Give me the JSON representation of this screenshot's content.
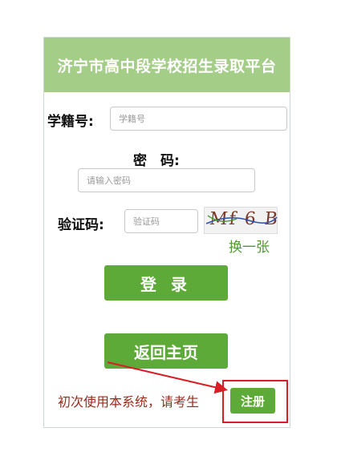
{
  "header": {
    "title": "济宁市高中段学校招生录取平台"
  },
  "form": {
    "student_id_label": "学籍号:",
    "student_id_placeholder": "学籍号",
    "password_label": "密　码:",
    "password_placeholder": "请输入密码",
    "captcha_label": "验证码:",
    "captcha_placeholder": "验证码",
    "captcha_text": "Mf 6 B",
    "refresh_label": "换一张"
  },
  "buttons": {
    "login_label": "登录",
    "home_label": "返回主页",
    "register_label": "注册"
  },
  "notice": {
    "text": "初次使用本系统，请考生"
  },
  "colors": {
    "header_bg": "#a4cd88",
    "button_bg": "#5eaa38",
    "notice_text": "#9a2a1a",
    "highlight": "#d61f26"
  }
}
